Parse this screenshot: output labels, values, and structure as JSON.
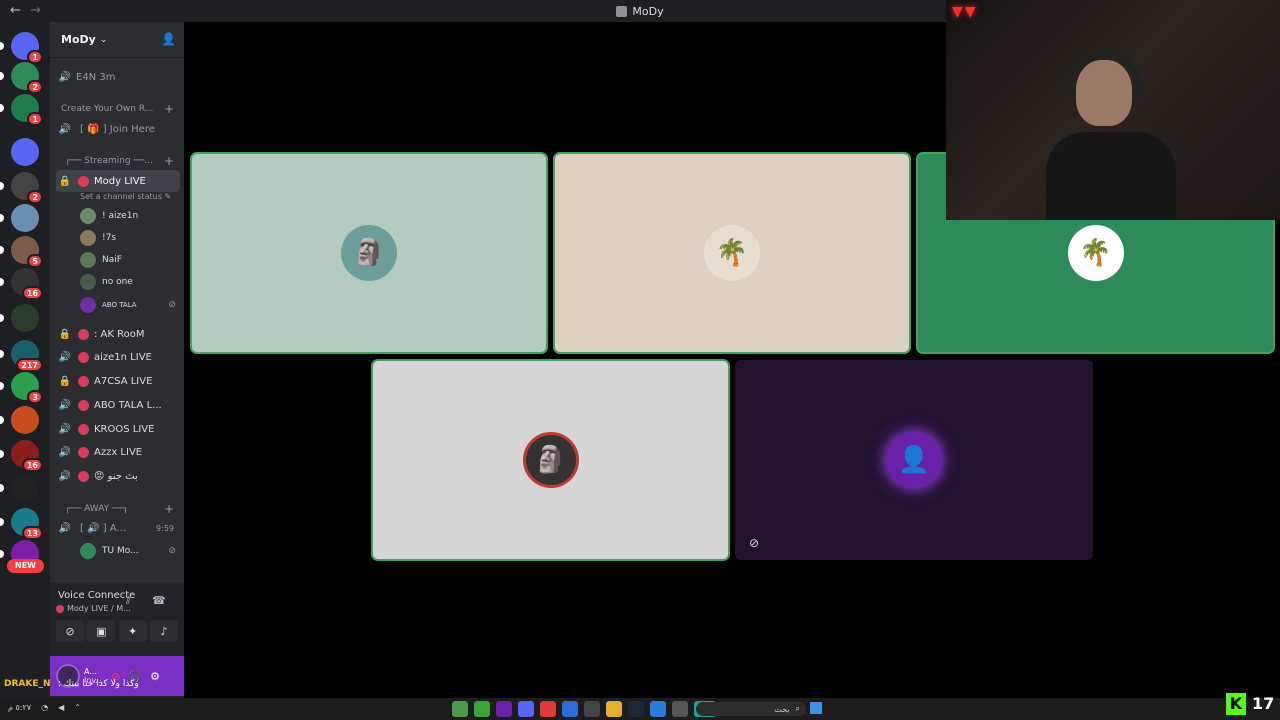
{
  "window": {
    "title": "MoDy"
  },
  "server_rail": {
    "servers": [
      {
        "name": "discord-home",
        "badge": "1",
        "color": "#5865f2"
      },
      {
        "name": "palm-server",
        "badge": "2",
        "color": "#2e8b57"
      },
      {
        "name": "server-3",
        "badge": "1",
        "color": "#1f7a4c"
      },
      {
        "name": "folder",
        "badge": "",
        "color": "#5865f2"
      },
      {
        "name": "server-5",
        "badge": "2",
        "color": "#444"
      },
      {
        "name": "server-6",
        "badge": "",
        "color": "#6a8fb0"
      },
      {
        "name": "server-7",
        "badge": "5",
        "color": "#7a5c4a"
      },
      {
        "name": "server-8",
        "badge": "16",
        "color": "#333"
      },
      {
        "name": "server-9",
        "badge": "",
        "color": "#2c3b2c"
      },
      {
        "name": "server-10",
        "badge": "217",
        "color": "#1a5e6a"
      },
      {
        "name": "server-11",
        "badge": "3",
        "color": "#2a9d4e"
      },
      {
        "name": "server-12",
        "badge": "",
        "color": "#c94d1c"
      },
      {
        "name": "server-13",
        "badge": "16",
        "color": "#8a1c1c"
      },
      {
        "name": "server-14",
        "badge": "",
        "color": "#222"
      },
      {
        "name": "server-15",
        "badge": "13",
        "color": "#1b7a8a"
      },
      {
        "name": "server-16",
        "badge": "",
        "color": "#7a1fa2"
      }
    ],
    "new_label": "NEW"
  },
  "sidebar": {
    "guild_name": "MoDy",
    "channels_top": [
      {
        "label": "E4N 3m",
        "icon": "speaker"
      }
    ],
    "category_1": "Create Your Own R...",
    "join_here": "[ 🎁 ] Join Here",
    "category_2": "┌── Streaming ──...",
    "active_channel": "Mody LIVE",
    "set_status": "Set a channel status ✎",
    "members": [
      {
        "name": "! aize1n",
        "color": "#6a8a6a"
      },
      {
        "name": "!7s",
        "color": "#8a7a5a"
      },
      {
        "name": "NaiF",
        "color": "#5a7a5a"
      },
      {
        "name": "no one",
        "color": "#4a5a4a"
      },
      {
        "name": "ABO TALA",
        "color": "#6a2fa2"
      }
    ],
    "channels": [
      {
        "label": ": AK RooM",
        "icon": "lock"
      },
      {
        "label": "aize1n LIVE",
        "icon": "speaker"
      },
      {
        "label": "A7CSA LIVE",
        "icon": "lock"
      },
      {
        "label": "ABO TALA L...",
        "icon": "speaker"
      },
      {
        "label": "KROOS LIVE",
        "icon": "speaker"
      },
      {
        "label": "Azzx LIVE",
        "icon": "speaker"
      },
      {
        "label": "😡 بث جنو",
        "icon": "speaker"
      }
    ],
    "category_3": "┌── AWAY ──┐",
    "away_channel": "[ 🔊 ] A...",
    "away_time": "9:59",
    "away_member": "TU Mo...",
    "voice": {
      "status": "Voice Connecte",
      "sub": "Mody LIVE / M..."
    },
    "user": {
      "name": "A...",
      "sub": "Inv..."
    }
  },
  "tiles": [
    {
      "name": "tile-aize1n",
      "bg": "#b5cbbf",
      "speaking": true,
      "emoji": "🗿"
    },
    {
      "name": "tile-7s",
      "bg": "#ddd1c1",
      "speaking": true,
      "emoji": "🌴"
    },
    {
      "name": "tile-naif",
      "bg": "#2e8b57",
      "speaking": true,
      "emoji": "🌴"
    },
    {
      "name": "tile-no-one",
      "bg": "#d6d6d6",
      "speaking": true,
      "emoji": "🗿"
    },
    {
      "name": "tile-abo-tala",
      "bg": "#22112f",
      "speaking": false,
      "emoji": "👤"
    }
  ],
  "overlay": {
    "drake_name": "DRAKE_N",
    "drake_msg": "وكذا ولا كذا حنا بيتك :",
    "viewers": "17",
    "kick_logo": "K"
  },
  "taskbar": {
    "search": "بحث",
    "left_text": "٥:٢٧ م"
  }
}
